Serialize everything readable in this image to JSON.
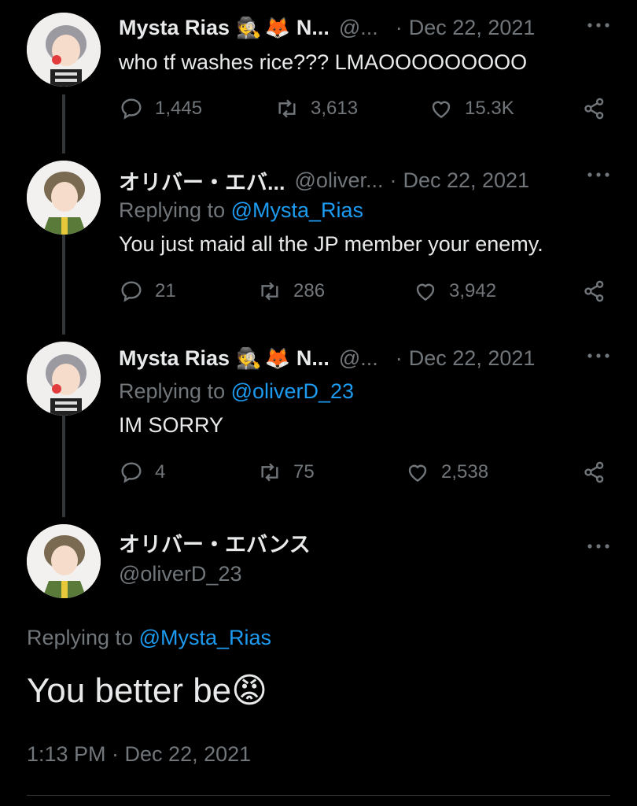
{
  "tweets": [
    {
      "name": "Mysta Rias",
      "emoji1": "🕵",
      "emoji2": "🦊",
      "name_suffix": "N...",
      "handle": "@...",
      "date": "Dec 22, 2021",
      "replying_prefix": "",
      "replying_to": "",
      "text": "who tf washes rice??? LMAOOOOOOOOO",
      "replies": "1,445",
      "retweets": "3,613",
      "likes": "15.3K"
    },
    {
      "name": "オリバー・エバ...",
      "handle": "@oliver...",
      "date": "Dec 22, 2021",
      "replying_prefix": "Replying to ",
      "replying_to": "@Mysta_Rias",
      "text": "You just maid all the JP member your enemy.",
      "replies": "21",
      "retweets": "286",
      "likes": "3,942"
    },
    {
      "name": "Mysta Rias",
      "emoji1": "🕵",
      "emoji2": "🦊",
      "name_suffix": "N...",
      "handle": "@...",
      "date": "Dec 22, 2021",
      "replying_prefix": "Replying to ",
      "replying_to": "@oliverD_23",
      "text": "IM SORRY",
      "replies": "4",
      "retweets": "75",
      "likes": "2,538"
    }
  ],
  "main": {
    "name": "オリバー・エバンス",
    "handle": "@oliverD_23",
    "replying_prefix": "Replying to ",
    "replying_to": "@Mysta_Rias",
    "text": "You better be",
    "emoji": "😡",
    "timestamp": "1:13 PM · Dec 22, 2021"
  },
  "separator": "·",
  "colors": {
    "background": "#000000",
    "text": "#e7e9ea",
    "muted": "#71767b",
    "link": "#1d9bf0",
    "thread": "#333639"
  },
  "icons": [
    "reply-icon",
    "retweet-icon",
    "like-icon",
    "share-icon",
    "more-icon"
  ]
}
